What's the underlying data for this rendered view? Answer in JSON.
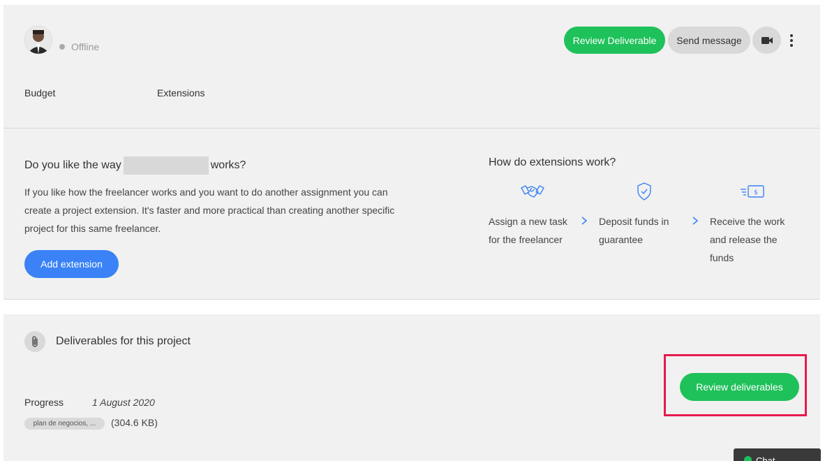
{
  "header": {
    "status": "Offline",
    "review_deliverable_label": "Review Deliverable",
    "send_message_label": "Send message",
    "tabs": [
      "Budget",
      "Extensions"
    ]
  },
  "extension": {
    "question_before": "Do you like the way",
    "question_after": "works?",
    "body": "If you like how the freelancer works and you want to do another assignment you can create a project extension. It's faster and more practical than creating another specific project for this same freelancer.",
    "add_label": "Add extension",
    "how_title": "How do extensions work?",
    "steps": [
      {
        "label": "Assign a new task for the freelancer",
        "icon": "handshake-icon"
      },
      {
        "label": "Deposit funds in guarantee",
        "icon": "shield-check-icon"
      },
      {
        "label": "Receive the work and release the funds",
        "icon": "money-icon"
      }
    ]
  },
  "deliverables": {
    "title": "Deliverables for this project",
    "review_label": "Review deliverables",
    "progress_label": "Progress",
    "progress_date": "1 August 2020",
    "file_name": "plan de negocios, ...",
    "file_size": "(304.6 KB)"
  },
  "chat": {
    "label": "Chat"
  },
  "colors": {
    "green": "#1fc15a",
    "blue": "#3a82f6",
    "highlight": "#e8194e",
    "icon_blue": "#3a82f6"
  }
}
